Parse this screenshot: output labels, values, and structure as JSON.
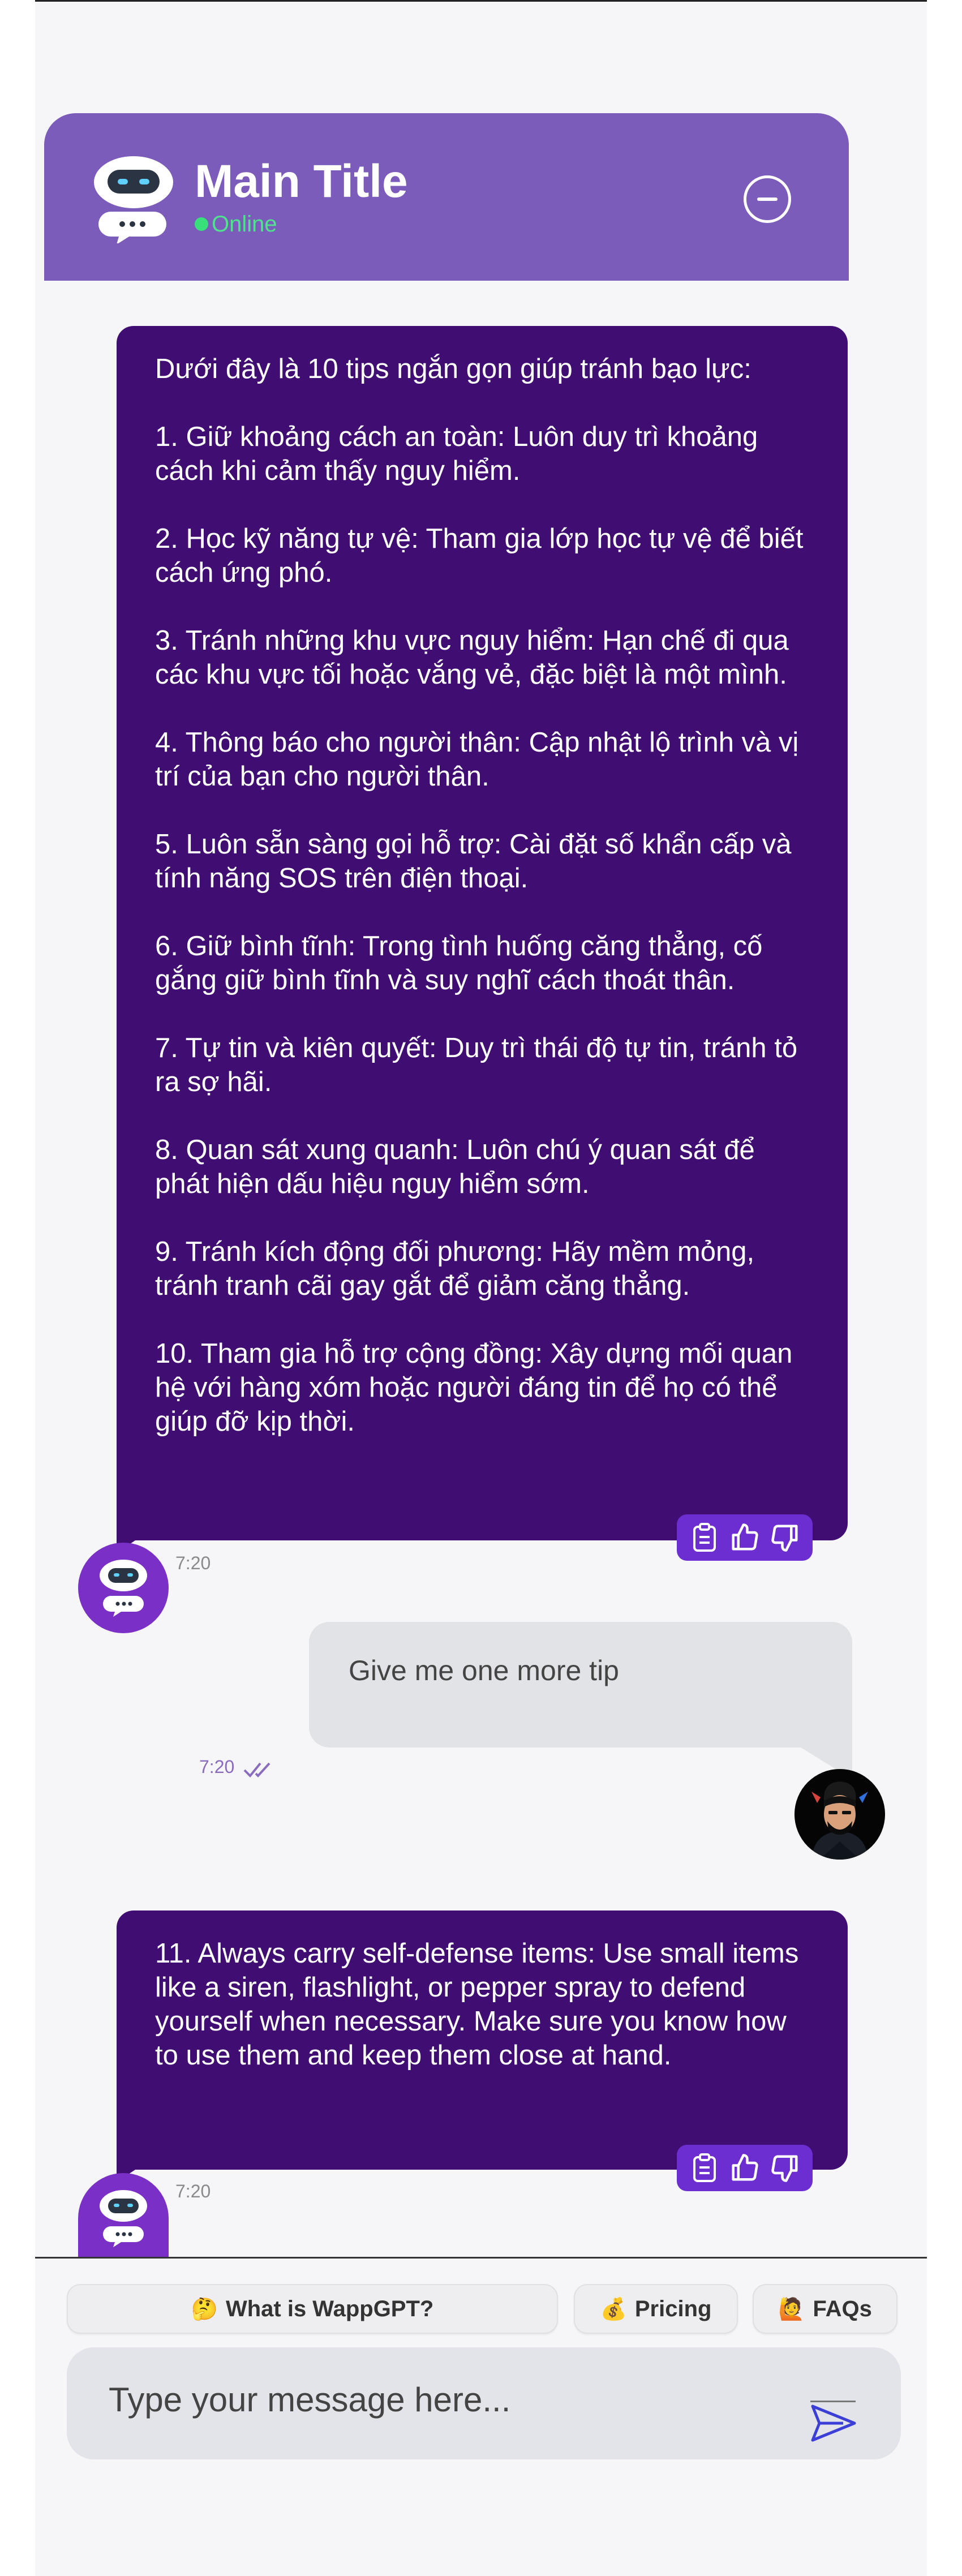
{
  "header": {
    "title": "Main Title",
    "status": "Online",
    "logo_icon": "robot-chat-icon",
    "minimize_icon": "minus-circle-icon"
  },
  "messages": [
    {
      "role": "bot",
      "paragraphs": [
        "Dưới đây là 10 tips ngắn gọn giúp tránh bạo lực:",
        "1. Giữ khoảng cách an toàn: Luôn duy trì khoảng cách khi cảm thấy nguy hiểm.",
        "2. Học kỹ năng tự vệ: Tham gia lớp học tự vệ để biết cách ứng phó.",
        "3. Tránh những khu vực nguy hiểm: Hạn chế đi qua các khu vực tối hoặc vắng vẻ, đặc biệt là một mình.",
        "4. Thông báo cho người thân: Cập nhật lộ trình và vị trí của bạn cho người thân.",
        "5. Luôn sẵn sàng gọi hỗ trợ: Cài đặt số khẩn cấp và tính năng SOS trên điện thoại.",
        "6. Giữ bình tĩnh: Trong tình huống căng thẳng, cố gắng giữ bình tĩnh và suy nghĩ cách thoát thân.",
        "7. Tự tin và kiên quyết: Duy trì thái độ tự tin, tránh tỏ ra sợ hãi.",
        "8. Quan sát xung quanh: Luôn chú ý quan sát để phát hiện dấu hiệu nguy hiểm sớm.",
        "9. Tránh kích động đối phương: Hãy mềm mỏng, tránh tranh cãi gay gắt để giảm căng thẳng.",
        "10. Tham gia hỗ trợ cộng đồng: Xây dựng mối quan hệ với hàng xóm hoặc người đáng tin để họ có thể giúp đỡ kịp thời."
      ],
      "time": "7:20"
    },
    {
      "role": "user",
      "text": "Give me one more tip",
      "time": "7:20",
      "status_icon": "double-check-icon"
    },
    {
      "role": "bot",
      "paragraphs": [
        "11. Always carry self-defense items: Use small items like a siren, flashlight, or pepper spray to defend yourself when necessary. Make sure you know how to use them and keep them close at hand."
      ],
      "time": "7:20"
    }
  ],
  "message_actions": [
    "clipboard-icon",
    "thumbs-up-icon",
    "thumbs-down-icon"
  ],
  "quick_replies": [
    {
      "emoji": "🤔",
      "label": "What is WappGPT?"
    },
    {
      "emoji": "💰",
      "label": "Pricing"
    },
    {
      "emoji": "🙋",
      "label": "FAQs"
    }
  ],
  "composer": {
    "placeholder": "Type your message here...",
    "send_icon": "send-icon"
  },
  "colors": {
    "header_bg": "#7b5cbb",
    "bot_bubble": "#400e72",
    "action_bar": "#6d2ed1",
    "user_bubble": "#e2e3e7",
    "online": "#38e07c"
  }
}
